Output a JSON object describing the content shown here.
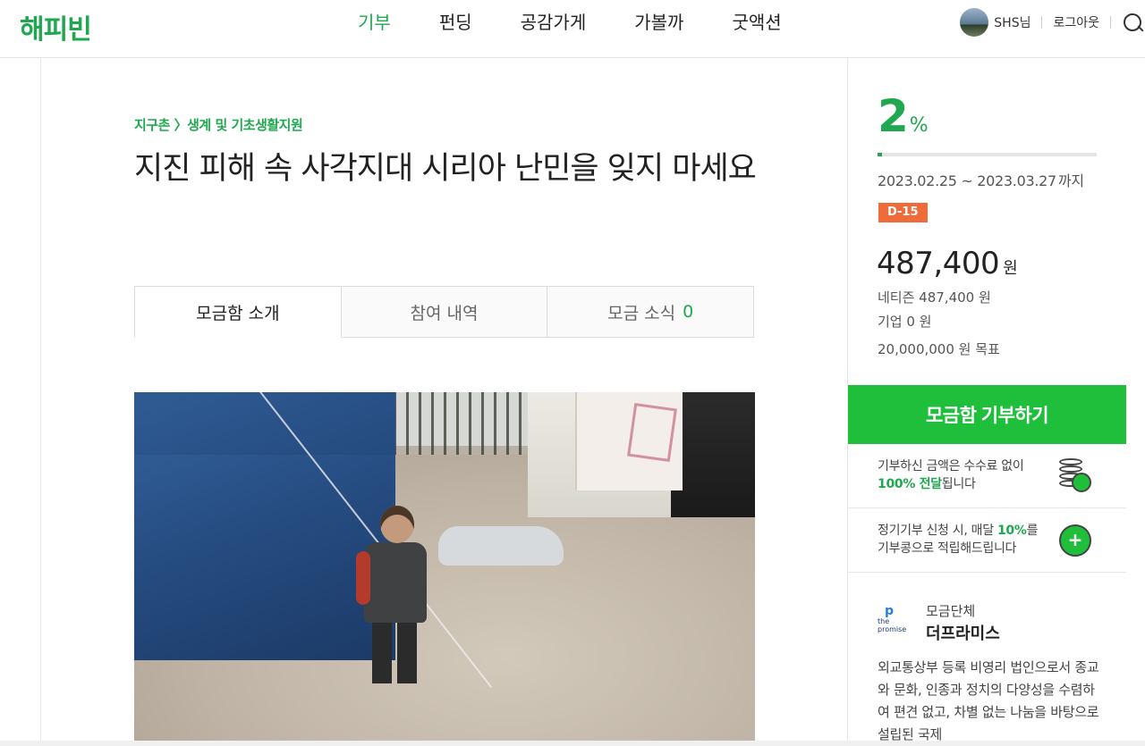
{
  "header": {
    "logo": "해피빈",
    "nav": [
      "기부",
      "펀딩",
      "공감가게",
      "가볼까",
      "굿액션"
    ],
    "active_nav": "기부",
    "user_name": "SHS님",
    "logout": "로그아웃"
  },
  "main": {
    "breadcrumb": "지구촌 〉생계 및 기초생활지원",
    "title": "지진 피해 속 사각지대 시리아 난민을 잊지 마세요",
    "tabs": [
      {
        "label": "모금함 소개"
      },
      {
        "label": "참여 내역"
      },
      {
        "label": "모금 소식",
        "count": "0"
      }
    ]
  },
  "sidebar": {
    "percent": "2",
    "percent_unit": "%",
    "progress_fraction": 0.02,
    "period": "2023.02.25 ~ 2023.03.27",
    "period_suffix": "까지",
    "dday": "D-15",
    "amount": "487,400",
    "amount_unit": "원",
    "netizen": "네티즌 487,400 원",
    "company": "기업 0 원",
    "goal": "20,000,000 원 목표",
    "donate_button": "모금함 기부하기",
    "fee_info_1": "기부하신 금액은 수수료 없이",
    "fee_info_2_strong": "100% 전달",
    "fee_info_2_rest": "됩니다",
    "regular_info_1_a": "정기기부 신청 시, 매달 ",
    "regular_info_1_strong": "10%",
    "regular_info_1_b": "를",
    "regular_info_2": "기부콩으로 적립해드립니다",
    "org_label": "모금단체",
    "org_name": "더프라미스",
    "org_logo_text": "the promise",
    "org_desc": "외교통상부 등록 비영리 법인으로서 종교와 문화, 인종과 정치의 다양성을 수렴하여 편견 없고, 차별 없는 나눔을 바탕으로 설립된 국제"
  },
  "colors": {
    "brand_green": "#1fa84f",
    "button_green": "#1fbf3c",
    "dday_orange": "#f06b3a"
  }
}
